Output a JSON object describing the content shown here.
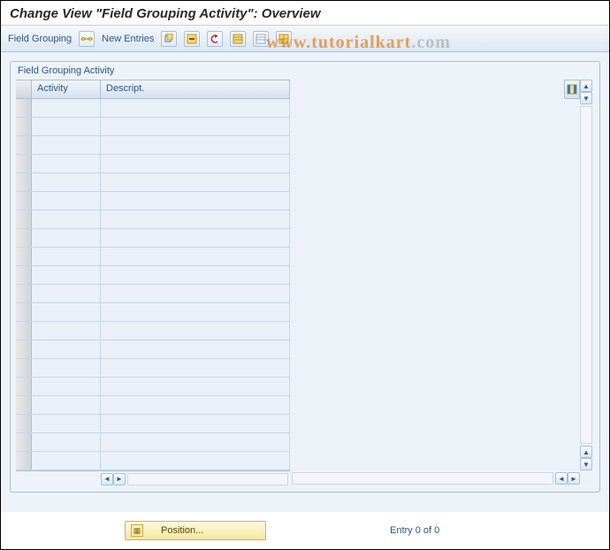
{
  "title": "Change View \"Field Grouping Activity\": Overview",
  "toolbar": {
    "field_grouping_label": "Field Grouping",
    "new_entries_label": "New Entries",
    "icon_glasses": "glasses-icon",
    "icon_copy": "copy-icon",
    "icon_delete": "delete-icon",
    "icon_undo": "undo-icon",
    "icon_select_all": "select-all-icon",
    "icon_deselect_all": "deselect-all-icon",
    "icon_table": "table-settings-icon"
  },
  "watermark": {
    "orange": "www.tutorialkart",
    "grey": ".com"
  },
  "groupbox": {
    "title": "Field Grouping Activity",
    "columns": {
      "activity": "Activity",
      "descript": "Descript."
    },
    "rows": [
      {
        "activity": "",
        "descript": ""
      },
      {
        "activity": "",
        "descript": ""
      },
      {
        "activity": "",
        "descript": ""
      },
      {
        "activity": "",
        "descript": ""
      },
      {
        "activity": "",
        "descript": ""
      },
      {
        "activity": "",
        "descript": ""
      },
      {
        "activity": "",
        "descript": ""
      },
      {
        "activity": "",
        "descript": ""
      },
      {
        "activity": "",
        "descript": ""
      },
      {
        "activity": "",
        "descript": ""
      },
      {
        "activity": "",
        "descript": ""
      },
      {
        "activity": "",
        "descript": ""
      },
      {
        "activity": "",
        "descript": ""
      },
      {
        "activity": "",
        "descript": ""
      },
      {
        "activity": "",
        "descript": ""
      },
      {
        "activity": "",
        "descript": ""
      },
      {
        "activity": "",
        "descript": ""
      },
      {
        "activity": "",
        "descript": ""
      },
      {
        "activity": "",
        "descript": ""
      },
      {
        "activity": "",
        "descript": ""
      }
    ]
  },
  "footer": {
    "position_label": "Position...",
    "entry_text": "Entry 0 of 0"
  }
}
